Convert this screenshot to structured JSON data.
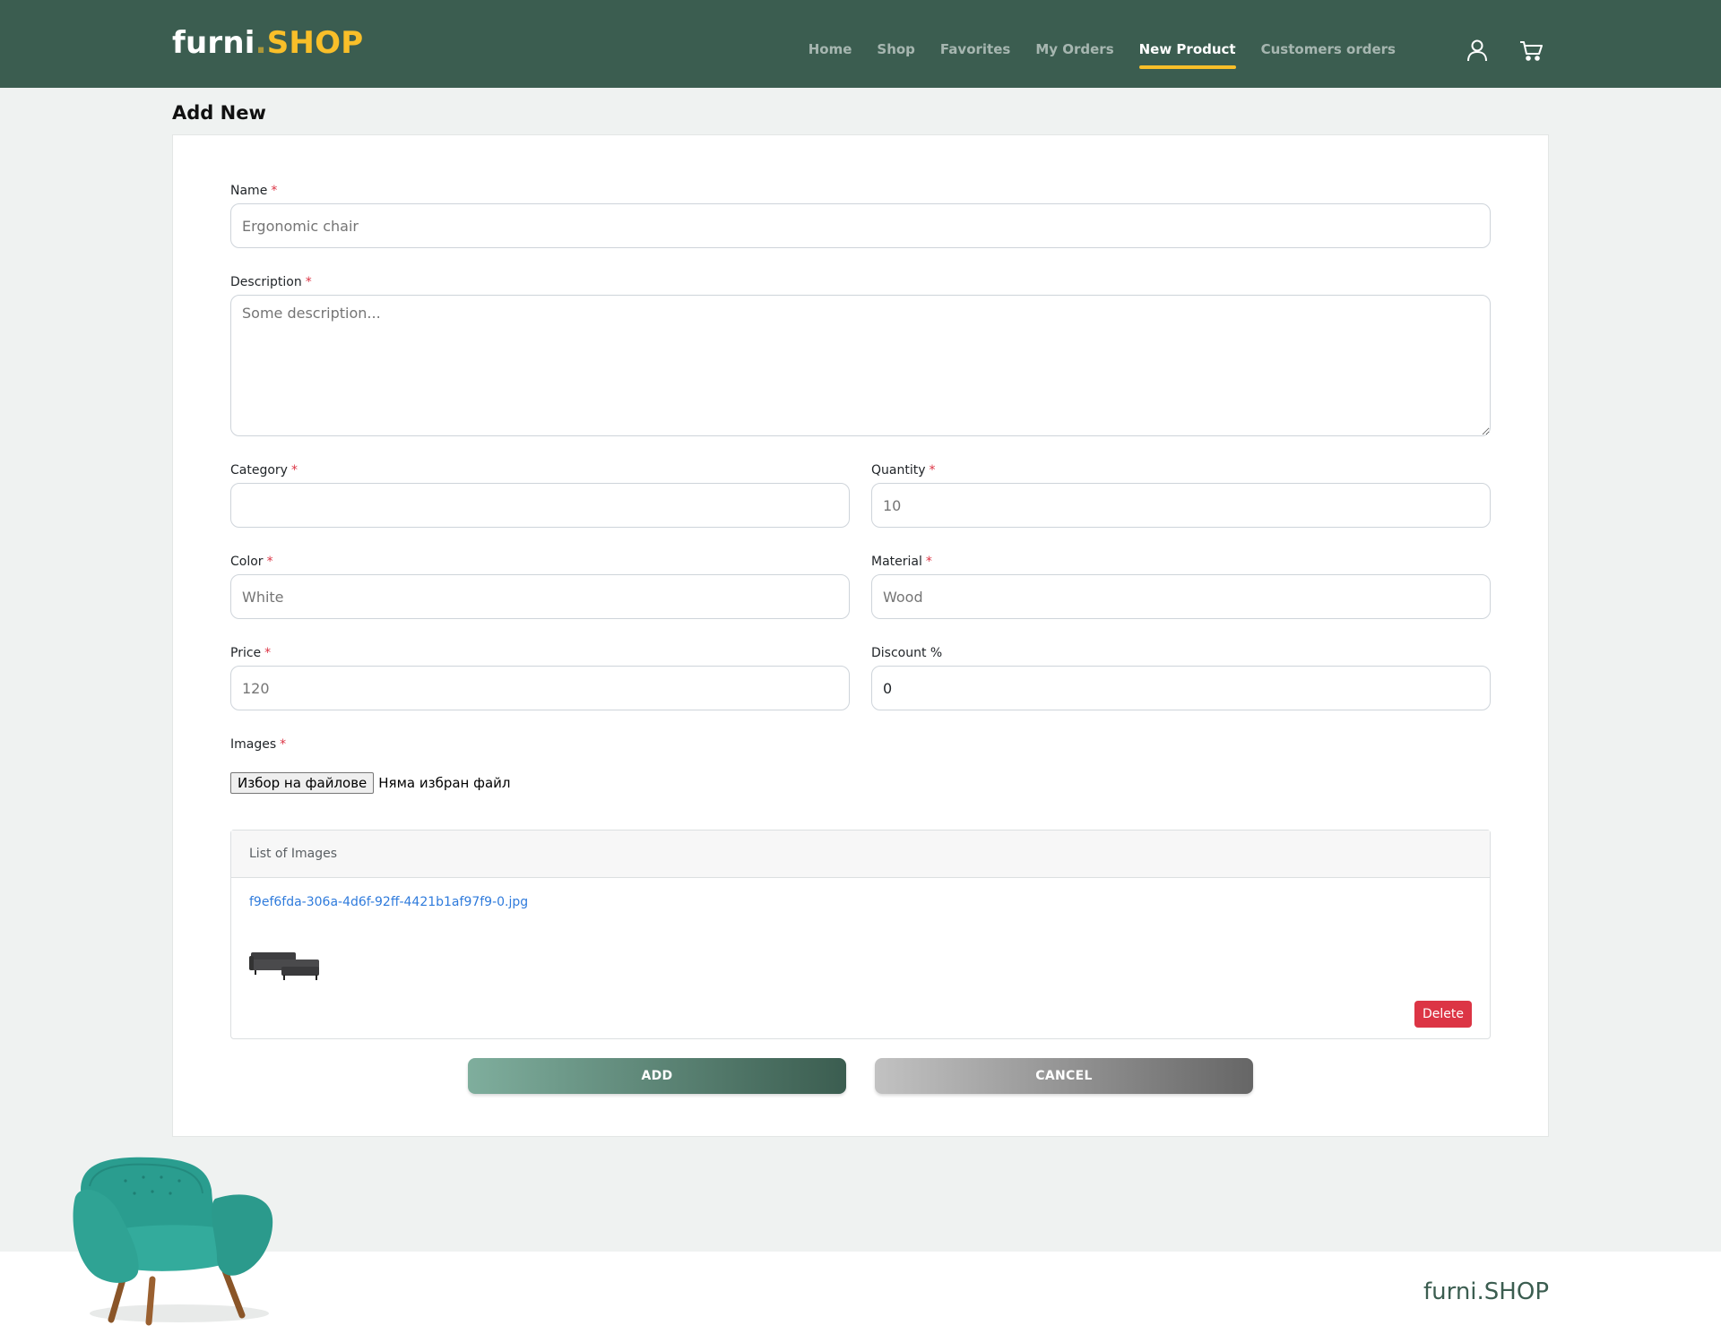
{
  "brand": {
    "name": "furni",
    "dot": ".",
    "accent": "SHOP"
  },
  "nav": {
    "links": [
      {
        "label": "Home"
      },
      {
        "label": "Shop"
      },
      {
        "label": "Favorites"
      },
      {
        "label": "My Orders"
      },
      {
        "label": "New Product"
      },
      {
        "label": "Customers orders"
      }
    ],
    "active": "New Product",
    "icons": [
      "user-icon",
      "cart-icon"
    ]
  },
  "page": {
    "title": "Add New"
  },
  "form": {
    "name": {
      "label": "Name",
      "required": "*",
      "placeholder": "Ergonomic chair",
      "value": ""
    },
    "description": {
      "label": "Description",
      "required": "*",
      "placeholder": "Some description...",
      "value": ""
    },
    "category": {
      "label": "Category",
      "required": "*",
      "value": ""
    },
    "quantity": {
      "label": "Quantity",
      "required": "*",
      "placeholder": "10",
      "value": ""
    },
    "color": {
      "label": "Color",
      "required": "*",
      "placeholder": "White",
      "value": ""
    },
    "material": {
      "label": "Material",
      "required": "*",
      "placeholder": "Wood",
      "value": ""
    },
    "price": {
      "label": "Price",
      "required": "*",
      "placeholder": "120",
      "value": ""
    },
    "discount": {
      "label": "Discount %",
      "value": "0"
    },
    "images": {
      "label": "Images",
      "required": "*",
      "choose_button": "Избор на файлове",
      "status": "Няма избран файл"
    }
  },
  "images_list": {
    "title": "List of Images",
    "items": [
      {
        "filename": "f9ef6fda-306a-4d6f-92ff-4421b1af97f9-0.jpg",
        "delete_label": "Delete"
      }
    ]
  },
  "actions": {
    "add_label": "ADD",
    "cancel_label": "CANCEL"
  },
  "footer": {
    "brand": "furni.SHOP"
  },
  "colors": {
    "header_bg": "#3b5d50",
    "accent": "#f9bf29",
    "danger": "#dc3545",
    "link": "#2f7bdc"
  }
}
